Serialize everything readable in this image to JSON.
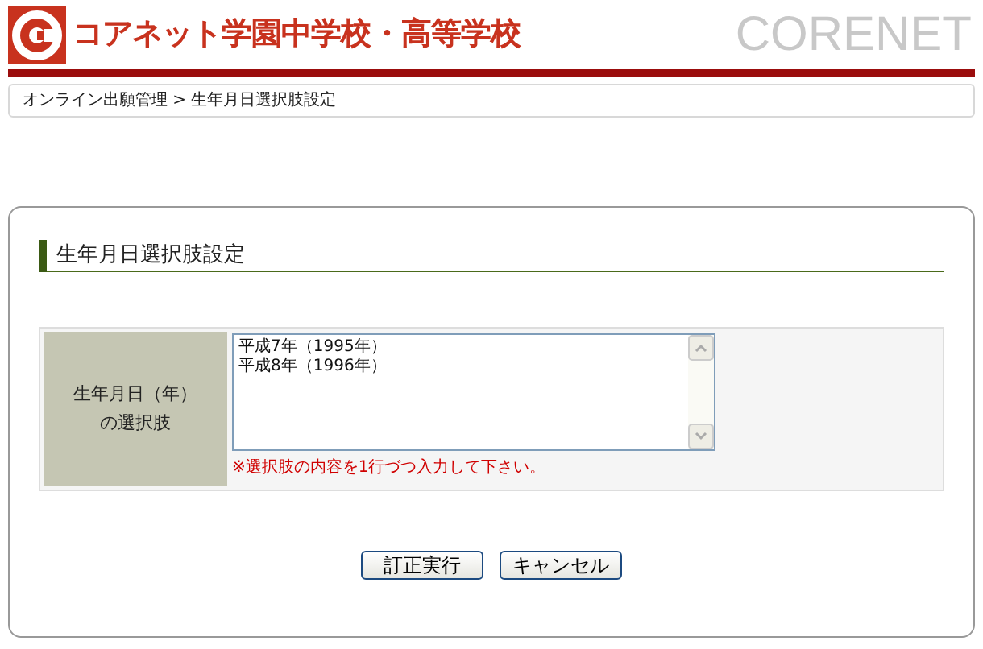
{
  "header": {
    "school_name": "コアネット学園中学校・高等学校",
    "brand": "CORENET"
  },
  "breadcrumb": "オンライン出願管理 > 生年月日選択肢設定",
  "section": {
    "title": "生年月日選択肢設定"
  },
  "form": {
    "rows": [
      {
        "label_lines": [
          "生年月日（年）",
          "の選択肢"
        ],
        "value_lines": [
          "平成7年（1995年）",
          "平成8年（1996年）"
        ],
        "note": "※選択肢の内容を1行づつ入力して下さい。"
      }
    ]
  },
  "buttons": [
    "訂正実行",
    "キャンセル"
  ]
}
